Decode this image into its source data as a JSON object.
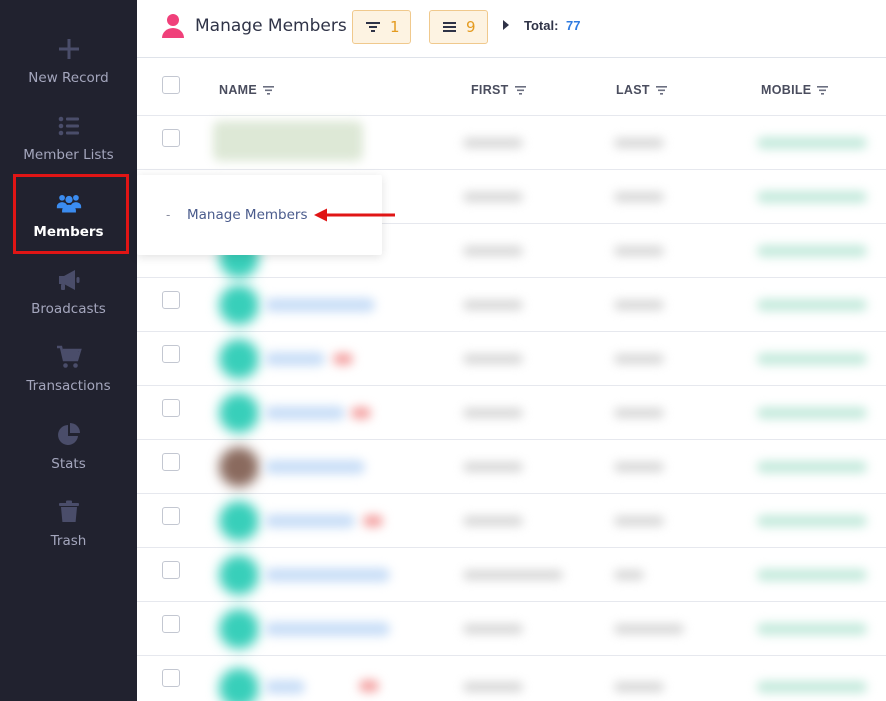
{
  "sidebar": {
    "items": [
      {
        "label": "New Record",
        "icon": "plus-icon"
      },
      {
        "label": "Member Lists",
        "icon": "list-icon"
      },
      {
        "label": "Members",
        "icon": "users-icon",
        "active": true
      },
      {
        "label": "Broadcasts",
        "icon": "megaphone-icon"
      },
      {
        "label": "Transactions",
        "icon": "cart-icon"
      },
      {
        "label": "Stats",
        "icon": "pie-chart-icon"
      },
      {
        "label": "Trash",
        "icon": "trash-icon"
      }
    ]
  },
  "header": {
    "title": "Manage Members",
    "filter_count": "1",
    "list_count": "9",
    "total_label": "Total:",
    "total_value": "77"
  },
  "table": {
    "columns": [
      "NAME",
      "FIRST",
      "LAST",
      "MOBILE"
    ]
  },
  "popup": {
    "dash": "-",
    "item_label": "Manage Members"
  },
  "colors": {
    "sidebar_bg": "#21222f",
    "accent_pink": "#f0407a",
    "chip_orange": "#e49b20",
    "total_blue": "#2f7be0",
    "highlight_red": "#e01515"
  }
}
